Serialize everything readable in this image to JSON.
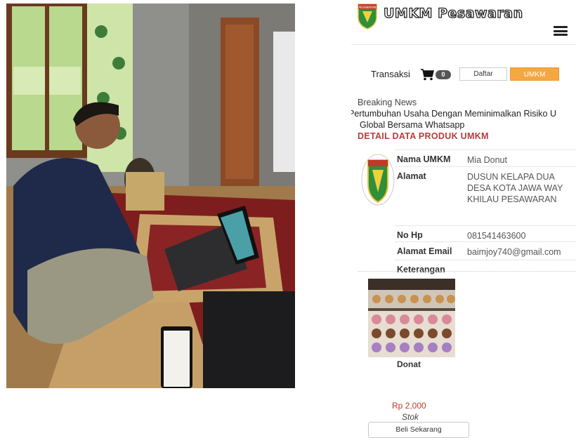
{
  "header": {
    "brand": "UMKM Pesawaran",
    "logo_label": "PESAWARAN"
  },
  "nav": {
    "transaksi_label": "Transaksi",
    "cart_count": "0",
    "daftar_label": "Daftar",
    "umkm_label": "UMKM"
  },
  "news": {
    "label": "Breaking News",
    "ticker_line1": "Pertumbuhan Usaha Dengan Meminimalkan Risiko U",
    "ticker_line2": "Global Bersama Whatsapp"
  },
  "section_title": "DETAIL DATA PRODUK UMKM",
  "info": [
    {
      "key": "Nama UMKM",
      "value": "Mia Donut"
    },
    {
      "key": "Alamat",
      "value": "DUSUN KELAPA DUA\nDESA KOTA JAWA WAY\nKHILAU PESAWARAN"
    },
    {
      "key": "No Hp",
      "value": "081541463600"
    },
    {
      "key": "Alamat Email",
      "value": "baimjoy740@gmail.com"
    },
    {
      "key": "Keterangan",
      "value": ""
    }
  ],
  "product": {
    "name": "Donat",
    "price": "Rp 2,000",
    "stock_label": "Stok",
    "buy_label": "Beli Sekarang"
  },
  "icons": {
    "cart": "cart-icon",
    "menu": "hamburger-menu-icon",
    "logo": "pesawaran-shield-logo"
  },
  "colors": {
    "accent": "#f5a742",
    "title_red": "#b63b3b",
    "price_red": "#c0392b",
    "badge": "#555555"
  }
}
